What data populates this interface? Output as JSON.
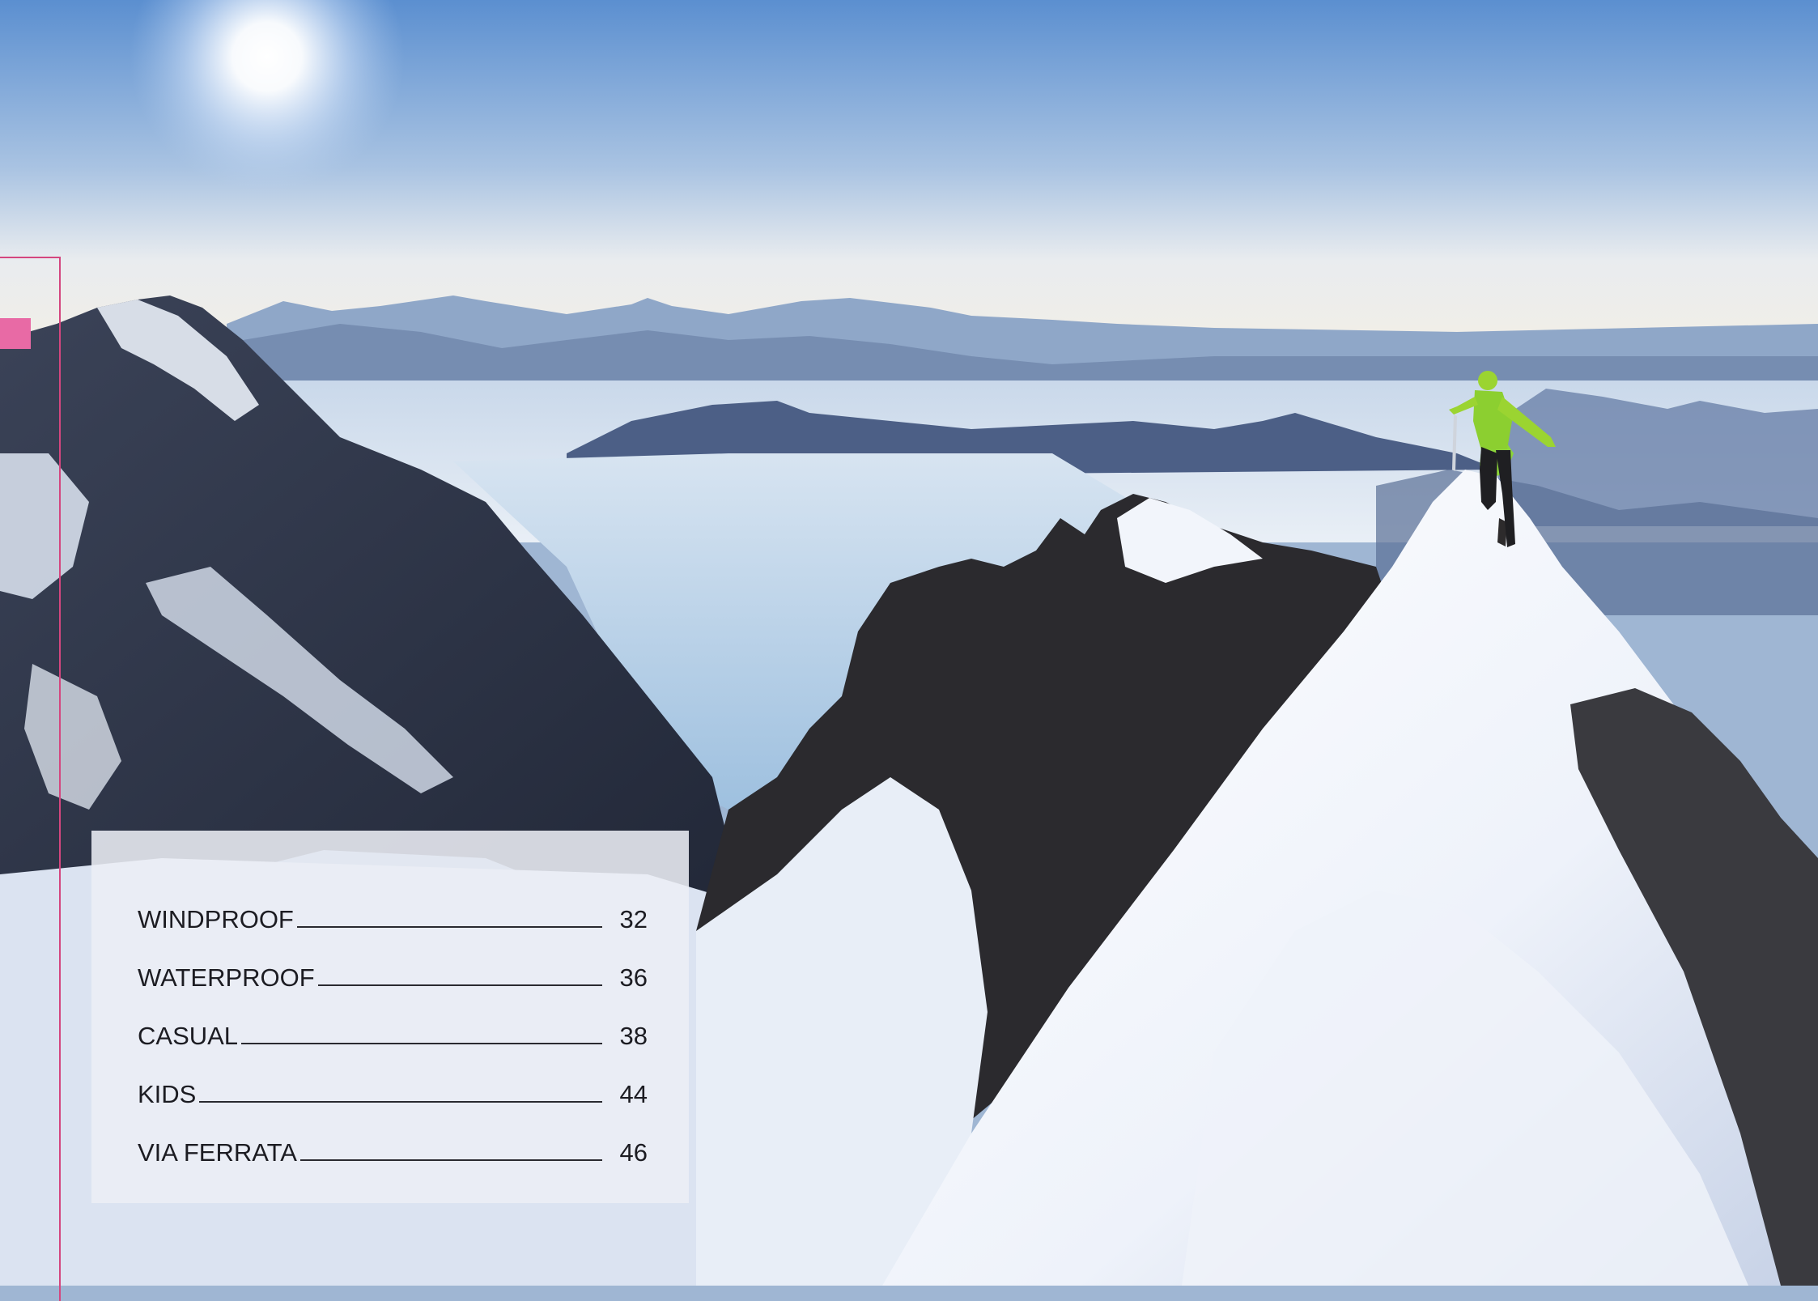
{
  "background": {
    "description_icon": "mountain-summit-photo",
    "sky_color": "#8eb0dc",
    "snow_color": "#f2f5fb",
    "accent": "#e86aa5"
  },
  "toc": {
    "items": [
      {
        "label": "WINDPROOF",
        "page": "32"
      },
      {
        "label": "WATERPROOF",
        "page": "36"
      },
      {
        "label": "CASUAL",
        "page": "38"
      },
      {
        "label": "KIDS",
        "page": "44"
      },
      {
        "label": "VIA FERRATA",
        "page": "46"
      }
    ]
  }
}
